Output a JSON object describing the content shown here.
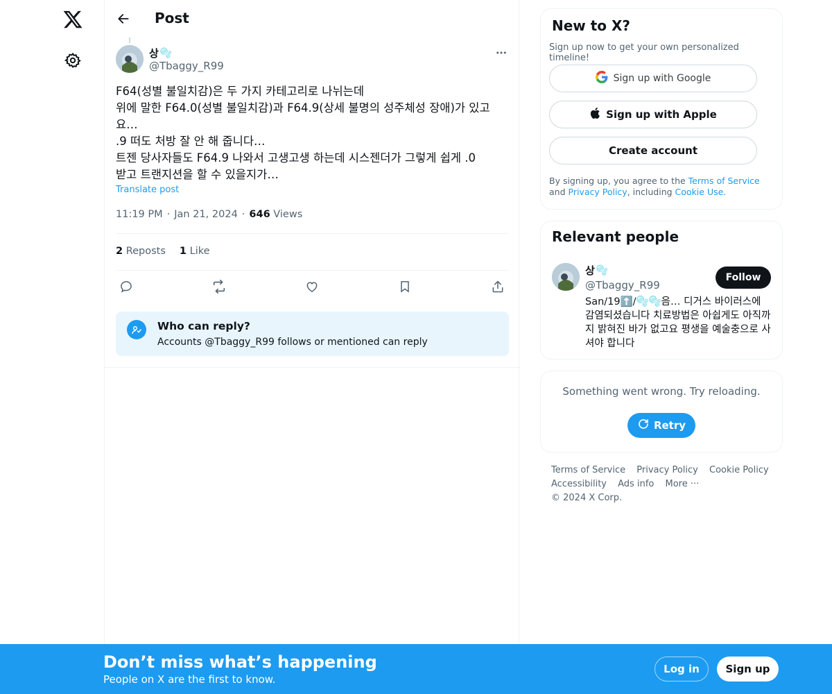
{
  "nav": {
    "logo_icon": "x-logo-icon",
    "settings_icon": "gear-icon"
  },
  "topbar": {
    "title": "Post",
    "back_icon": "arrow-left-icon"
  },
  "post": {
    "author_name": "상",
    "author_name_emoji": "🫧",
    "author_handle": "@Tbaggy_R99",
    "text_lines": [
      "F64(성별 불일치감)은 두 가지 카테고리로 나뉘는데",
      "위에 말한 F64.0(성별 불일치감)과 F64.9(상세 불명의 성주체성 장애)가 있고",
      "요…",
      ".9 떠도 처방 잘 안 해 줍니다…",
      "트젠 당사자들도 F64.9 나와서 고생고생 하는데 시스젠더가 그렇게 쉽게 .0",
      "받고 트랜지션을 할 수 있을지가…"
    ],
    "translate_label": "Translate post",
    "time": "11:19 PM",
    "date": "Jan 21, 2024",
    "views_count": "646",
    "views_label": "Views",
    "reposts_count": "2",
    "reposts_label": "Reposts",
    "likes_count": "1",
    "likes_label": "Like"
  },
  "who_can_reply": {
    "title": "Who can reply?",
    "subtitle": "Accounts @Tbaggy_R99 follows or mentioned can reply"
  },
  "new_to_x": {
    "title": "New to X?",
    "subtitle": "Sign up now to get your own personalized timeline!",
    "google_label": "Sign up with Google",
    "apple_label": "Sign up with Apple",
    "create_label": "Create account",
    "legal_prefix": "By signing up, you agree to the ",
    "terms_link": "Terms of Service",
    "legal_and": " and ",
    "privacy_link": "Privacy Policy",
    "legal_including": ", including ",
    "cookie_link": "Cookie Use."
  },
  "relevant_people": {
    "title": "Relevant people",
    "name": "상",
    "name_emoji": "🫧",
    "handle": "@Tbaggy_R99",
    "follow_label": "Follow",
    "bio": "San/19⬆️/🫧🫧음… 디거스 바이러스에 감염되셨습니다 치료방법은 아쉽게도 아직까지 밝혀진 바가 없고요 평생을 예술충으로 사셔야 합니다"
  },
  "error_card": {
    "message": "Something went wrong. Try reloading.",
    "retry_label": "Retry"
  },
  "footer": {
    "terms": "Terms of Service",
    "privacy": "Privacy Policy",
    "cookie": "Cookie Policy",
    "accessibility": "Accessibility",
    "ads": "Ads info",
    "more": "More ···",
    "copyright": "© 2024 X Corp."
  },
  "banner": {
    "title": "Don’t miss what’s happening",
    "subtitle": "People on X are the first to know.",
    "login_label": "Log in",
    "signup_label": "Sign up"
  },
  "colors": {
    "accent": "#1d9bf0",
    "text": "#0f1419",
    "muted": "#536471",
    "border": "#eff3f4"
  }
}
